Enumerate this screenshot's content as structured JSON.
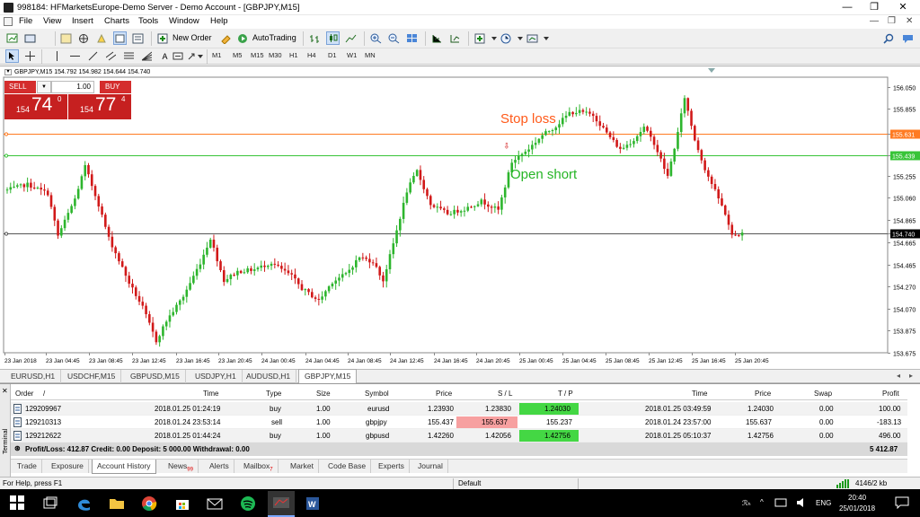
{
  "window": {
    "title": "998184: HFMarketsEurope-Demo Server - Demo Account - [GBPJPY,M15]",
    "controls": [
      "—",
      "❐",
      "✕"
    ]
  },
  "menu": {
    "items": [
      "File",
      "View",
      "Insert",
      "Charts",
      "Tools",
      "Window",
      "Help"
    ],
    "right_controls": [
      "—",
      "❐",
      "✕"
    ]
  },
  "toolbar": {
    "new_order_label": "New Order",
    "autotrading_label": "AutoTrading",
    "timeframes": [
      "M1",
      "M5",
      "M15",
      "M30",
      "H1",
      "H4",
      "D1",
      "W1",
      "MN"
    ]
  },
  "chart": {
    "symbol_info": "GBPJPY,M15  154.792 154.982 154.644 154.740",
    "one_click": {
      "sell_label": "SELL",
      "buy_label": "BUY",
      "lot": "1.00",
      "sell_prefix": "154",
      "sell_big": "74",
      "sell_sup": "0",
      "buy_prefix": "154",
      "buy_big": "77",
      "buy_sup": "4"
    },
    "annotations": {
      "stop_loss": "Stop loss",
      "open_short": "Open short"
    },
    "colors": {
      "bull": "#2db52d",
      "bear": "#d11919",
      "stop_loss_line": "#ff7b22",
      "open_line": "#38c438",
      "current_line": "#555555",
      "stop_loss_text": "#ff5a1a",
      "open_text": "#26b526"
    }
  },
  "chart_data": {
    "type": "candlestick",
    "symbol": "GBPJPY",
    "timeframe": "M15",
    "ylim": [
      153.6,
      156.2
    ],
    "y_ticks": [
      "156.050",
      "155.855",
      "155.631",
      "155.439",
      "155.255",
      "155.060",
      "154.865",
      "154.740",
      "154.665",
      "154.465",
      "154.270",
      "154.070",
      "153.875",
      "153.675"
    ],
    "x_ticks": [
      "23 Jan 2018",
      "23 Jan 04:45",
      "23 Jan 08:45",
      "23 Jan 12:45",
      "23 Jan 16:45",
      "23 Jan 20:45",
      "24 Jan 00:45",
      "24 Jan 04:45",
      "24 Jan 08:45",
      "24 Jan 12:45",
      "24 Jan 16:45",
      "24 Jan 20:45",
      "25 Jan 00:45",
      "25 Jan 04:45",
      "25 Jan 08:45",
      "25 Jan 12:45",
      "25 Jan 16:45",
      "25 Jan 20:45"
    ],
    "price_lines": [
      {
        "name": "stop loss",
        "value": 155.631
      },
      {
        "name": "open short",
        "value": 155.439
      },
      {
        "name": "bid",
        "value": 154.74
      }
    ],
    "close_path": [
      [
        0,
        155.13
      ],
      [
        6,
        155.18
      ],
      [
        12,
        155.1
      ],
      [
        15,
        154.72
      ],
      [
        20,
        155.05
      ],
      [
        23,
        155.34
      ],
      [
        27,
        155.0
      ],
      [
        30,
        154.7
      ],
      [
        36,
        154.3
      ],
      [
        40,
        154.08
      ],
      [
        44,
        153.78
      ],
      [
        47,
        153.96
      ],
      [
        52,
        154.18
      ],
      [
        57,
        154.48
      ],
      [
        60,
        154.7
      ],
      [
        64,
        154.32
      ],
      [
        68,
        154.4
      ],
      [
        73,
        154.42
      ],
      [
        78,
        154.48
      ],
      [
        84,
        154.36
      ],
      [
        87,
        154.25
      ],
      [
        92,
        154.14
      ],
      [
        96,
        154.31
      ],
      [
        100,
        154.38
      ],
      [
        104,
        154.53
      ],
      [
        108,
        154.49
      ],
      [
        111,
        154.32
      ],
      [
        114,
        154.65
      ],
      [
        118,
        155.12
      ],
      [
        121,
        155.3
      ],
      [
        125,
        155.0
      ],
      [
        130,
        154.92
      ],
      [
        135,
        154.96
      ],
      [
        140,
        155.03
      ],
      [
        145,
        154.95
      ],
      [
        149,
        155.38
      ],
      [
        154,
        155.5
      ],
      [
        158,
        155.62
      ],
      [
        162,
        155.7
      ],
      [
        166,
        155.82
      ],
      [
        169,
        155.83
      ],
      [
        173,
        155.8
      ],
      [
        177,
        155.64
      ],
      [
        181,
        155.49
      ],
      [
        185,
        155.58
      ],
      [
        188,
        155.69
      ],
      [
        191,
        155.55
      ],
      [
        195,
        155.25
      ],
      [
        198,
        155.64
      ],
      [
        200,
        155.96
      ],
      [
        203,
        155.58
      ],
      [
        206,
        155.32
      ],
      [
        209,
        155.12
      ],
      [
        212,
        154.92
      ],
      [
        214,
        154.72
      ],
      [
        217,
        154.74
      ]
    ]
  },
  "chart_tabs": [
    {
      "label": "EURUSD,H1",
      "active": false
    },
    {
      "label": "USDCHF,M15",
      "active": false
    },
    {
      "label": "GBPUSD,M15",
      "active": false
    },
    {
      "label": "USDJPY,H1",
      "active": false
    },
    {
      "label": "AUDUSD,H1",
      "active": false
    },
    {
      "label": "GBPJPY,M15",
      "active": true
    }
  ],
  "terminal": {
    "side_label": "Terminal",
    "columns": [
      "Order",
      "/",
      "Time",
      "Type",
      "Size",
      "Symbol",
      "Price",
      "S / L",
      "T / P",
      "Time",
      "Price",
      "Swap",
      "Profit"
    ],
    "rows": [
      {
        "order": "129209967",
        "time": "2018.01.25 01:24:19",
        "type": "buy",
        "size": "1.00",
        "symbol": "eurusd",
        "price": "1.23930",
        "sl": "1.23830",
        "tp": "1.24030",
        "close_time": "2018.01.25 03:49:59",
        "close_price": "1.24030",
        "swap": "0.00",
        "profit": "100.00"
      },
      {
        "order": "129210313",
        "time": "2018.01.24 23:53:14",
        "type": "sell",
        "size": "1.00",
        "symbol": "gbpjpy",
        "price": "155.437",
        "sl": "155.637",
        "tp": "155.237",
        "close_time": "2018.01.24 23:57:00",
        "close_price": "155.637",
        "swap": "0.00",
        "profit": "-183.13"
      },
      {
        "order": "129212622",
        "time": "2018.01.25 01:44:24",
        "type": "buy",
        "size": "1.00",
        "symbol": "gbpusd",
        "price": "1.42260",
        "sl": "1.42056",
        "tp": "1.42756",
        "close_time": "2018.01.25 05:10:37",
        "close_price": "1.42756",
        "swap": "0.00",
        "profit": "496.00"
      }
    ],
    "summary": "Profit/Loss: 412.87  Credit: 0.00  Deposit: 5 000.00  Withdrawal: 0.00",
    "summary_total": "5 412.87",
    "tabs": [
      {
        "label": "Trade",
        "active": false,
        "badge": ""
      },
      {
        "label": "Exposure",
        "active": false,
        "badge": ""
      },
      {
        "label": "Account History",
        "active": true,
        "badge": ""
      },
      {
        "label": "News",
        "active": false,
        "badge": "99"
      },
      {
        "label": "Alerts",
        "active": false,
        "badge": ""
      },
      {
        "label": "Mailbox",
        "active": false,
        "badge": "7"
      },
      {
        "label": "Market",
        "active": false,
        "badge": ""
      },
      {
        "label": "Code Base",
        "active": false,
        "badge": ""
      },
      {
        "label": "Experts",
        "active": false,
        "badge": ""
      },
      {
        "label": "Journal",
        "active": false,
        "badge": ""
      }
    ]
  },
  "statusbar": {
    "help": "For Help, press F1",
    "profile": "Default",
    "traffic": "4146/2 kb"
  },
  "taskbar": {
    "time": "20:40",
    "date": "25/01/2018",
    "lang": "ENG"
  }
}
